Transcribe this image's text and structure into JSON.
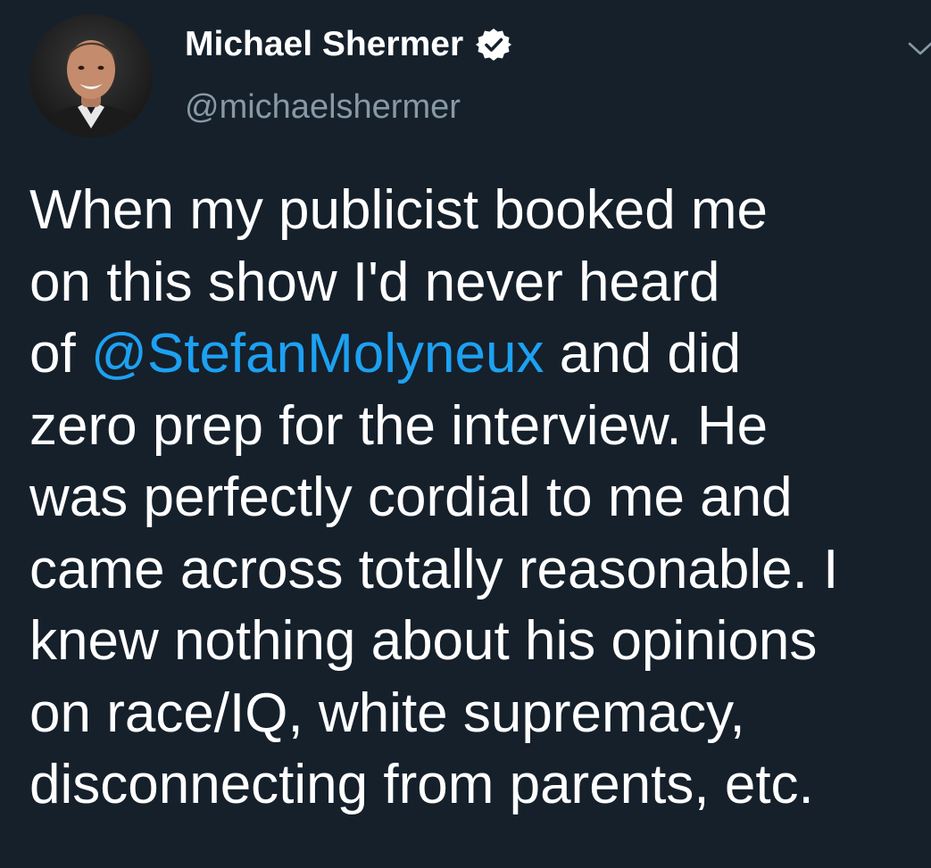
{
  "user": {
    "display_name": "Michael Shermer",
    "handle": "@michaelshermer",
    "verified_icon": "verified-badge-icon"
  },
  "menu": {
    "icon": "chevron-down-icon"
  },
  "tweet": {
    "lines": [
      {
        "text": "When my publicist booked me"
      },
      {
        "text": "on this show I'd never heard"
      },
      {
        "before": "of ",
        "mention": "@StefanMolyneux",
        "after": " and did"
      },
      {
        "text": "zero prep for the interview. He"
      },
      {
        "text": "was perfectly cordial to me and"
      },
      {
        "text": "came across totally reasonable. I"
      },
      {
        "text": "knew nothing about his opinions"
      },
      {
        "text": "on race/IQ, white supremacy,"
      },
      {
        "text": "disconnecting from parents, etc."
      }
    ]
  },
  "colors": {
    "background": "#15202b",
    "text": "#ffffff",
    "secondary": "#8899a6",
    "link": "#1da1f2"
  }
}
